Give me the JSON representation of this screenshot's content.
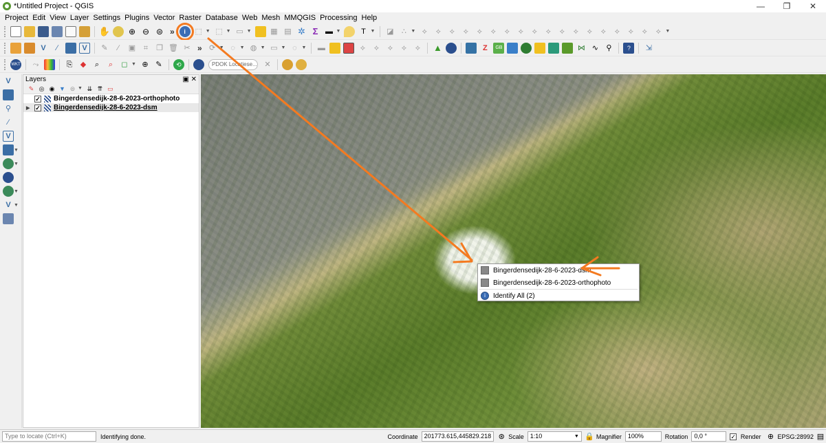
{
  "window": {
    "title": "*Untitled Project - QGIS",
    "min": "—",
    "max": "❐",
    "close": "✕"
  },
  "menu": [
    "Project",
    "Edit",
    "View",
    "Layer",
    "Settings",
    "Plugins",
    "Vector",
    "Raster",
    "Database",
    "Web",
    "Mesh",
    "MMQGIS",
    "Processing",
    "Help"
  ],
  "toolbar": {
    "overflow": "»",
    "identify_icon": "identify-features-icon",
    "sigma": "Σ"
  },
  "locator_search": {
    "placeholder": "PDOK Locatiese..."
  },
  "layers_panel": {
    "title": "Layers",
    "float": "▣",
    "close": "✕",
    "layers": [
      {
        "name": "Bingerdensedijk-28-6-2023-orthophoto",
        "checked": "✓"
      },
      {
        "name": "Bingerdensedijk-28-6-2023-dsm",
        "checked": "✓"
      }
    ]
  },
  "context_menu": {
    "items": [
      {
        "label": "Bingerdensedijk-28-6-2023-dsm"
      },
      {
        "label": "Bingerdensedijk-28-6-2023-orthophoto"
      }
    ],
    "identify_all": "Identify All (2)"
  },
  "statusbar": {
    "locate_placeholder": "Type to locate (Ctrl+K)",
    "message": "Identifying done.",
    "coordinate_label": "Coordinate",
    "coordinate_value": "201773.615,445829.218",
    "scale_label": "Scale",
    "scale_value": "1:10",
    "magnifier_label": "Magnifier",
    "magnifier_value": "100%",
    "rotation_label": "Rotation",
    "rotation_value": "0,0 °",
    "render_label": "Render",
    "render_checked": "✓",
    "crs": "EPSG:28992"
  },
  "colors": {
    "annotation": "#f47a20",
    "qgis_green": "#589632"
  }
}
